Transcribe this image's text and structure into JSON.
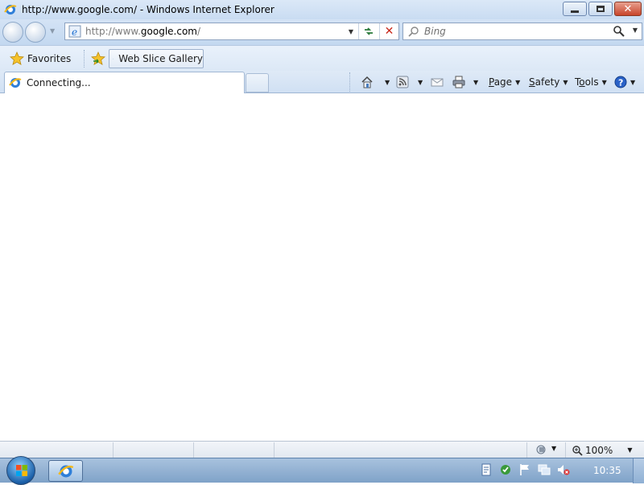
{
  "window": {
    "title": "http://www.google.com/ - Windows Internet Explorer"
  },
  "address": {
    "url_prefix": "http://www.",
    "url_domain": "google.com",
    "url_suffix": "/"
  },
  "search": {
    "placeholder": "Bing"
  },
  "favorites_bar": {
    "favorites_label": "Favorites",
    "web_slice_label": "Web Slice Gallery"
  },
  "tab": {
    "label": "Connecting..."
  },
  "command_bar": {
    "page_label_first": "P",
    "page_label_rest": "age",
    "safety_label_first": "S",
    "safety_label_rest": "afety",
    "tools_label_pre": "T",
    "tools_label_ul": "o",
    "tools_label_rest": "ols"
  },
  "status_bar": {
    "zoom": "100%"
  },
  "taskbar": {
    "clock": "10:35"
  },
  "colors": {
    "ie_blue": "#1f6fd0",
    "ie_ring": "#f2b81a",
    "stop_red": "#c8281a"
  }
}
